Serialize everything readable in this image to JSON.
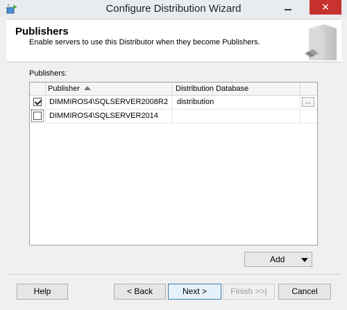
{
  "window": {
    "title": "Configure Distribution Wizard",
    "close_glyph": "✕"
  },
  "header": {
    "title": "Publishers",
    "subtitle": "Enable servers to use this Distributor when they become Publishers."
  },
  "main": {
    "publishers_label": "Publishers:",
    "columns": {
      "publisher": "Publisher",
      "distribution_database": "Distribution Database"
    },
    "rows": [
      {
        "checked": true,
        "publisher": "DIMMIROS4\\SQLSERVER2008R2",
        "database": "distribution",
        "ellipsis": "..."
      },
      {
        "checked": false,
        "publisher": "DIMMIROS4\\SQLSERVER2014",
        "database": ""
      }
    ],
    "add_label": "Add"
  },
  "footer": {
    "help": "Help",
    "back": "< Back",
    "next": "Next >",
    "finish": "Finish >>|",
    "cancel": "Cancel"
  },
  "icons": {
    "app": "wizard-app-icon",
    "sort": "sort-ascending-icon",
    "server": "server-graphic"
  }
}
